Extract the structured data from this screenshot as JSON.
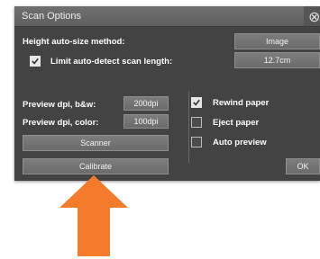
{
  "dialog": {
    "title": "Scan Options",
    "close_icon": "close-icon"
  },
  "height_method": {
    "label": "Height auto-size method:",
    "value": "Image"
  },
  "limit_scan": {
    "label": "Limit auto-detect scan length:",
    "checked": true,
    "value": "12.7cm"
  },
  "preview_bw": {
    "label": "Preview dpi, b&w:",
    "value": "200dpi"
  },
  "preview_color": {
    "label": "Preview dpi, color:",
    "value": "100dpi"
  },
  "buttons": {
    "scanner": "Scanner",
    "calibrate": "Calibrate",
    "ok": "OK"
  },
  "options": [
    {
      "label": "Rewind paper",
      "checked": true
    },
    {
      "label": "Eject paper",
      "checked": false
    },
    {
      "label": "Auto preview",
      "checked": false
    }
  ],
  "colors": {
    "dialog_bg": "#434343",
    "button_bg": "#777777",
    "arrow": "#f47a2c"
  },
  "icons": {
    "checkmark": "checkmark-icon",
    "arrow": "arrow-up-icon"
  }
}
